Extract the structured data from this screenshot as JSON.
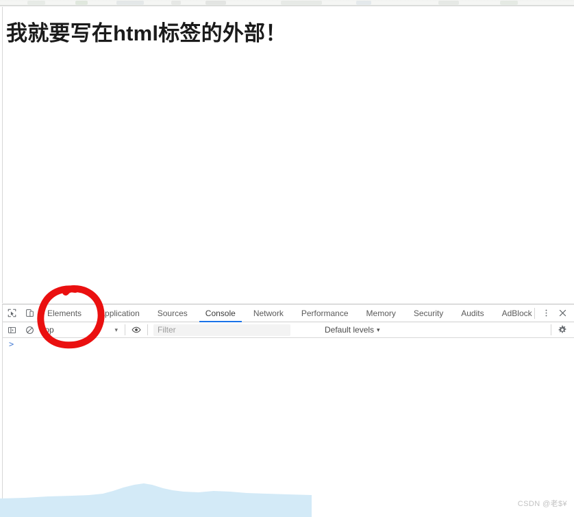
{
  "page": {
    "heading": "我就要写在html标签的外部！"
  },
  "devtools": {
    "tabs": [
      {
        "label": "Elements",
        "active": false
      },
      {
        "label": "Application",
        "active": false
      },
      {
        "label": "Sources",
        "active": false
      },
      {
        "label": "Console",
        "active": true
      },
      {
        "label": "Network",
        "active": false
      },
      {
        "label": "Performance",
        "active": false
      },
      {
        "label": "Memory",
        "active": false
      },
      {
        "label": "Security",
        "active": false
      },
      {
        "label": "Audits",
        "active": false
      },
      {
        "label": "AdBlock",
        "active": false
      }
    ],
    "left_icons": [
      {
        "name": "inspect-element-icon"
      },
      {
        "name": "device-toolbar-icon"
      }
    ],
    "right_icons": [
      {
        "name": "more-options-icon",
        "glyph": "⋮"
      },
      {
        "name": "close-devtools-icon",
        "glyph": "×"
      }
    ],
    "console_toolbar": {
      "sidebar_toggle": "console-sidebar-icon",
      "clear_console": "clear-console-icon",
      "context": "top",
      "context_caret": "▾",
      "eye_icon": "live-expression-icon",
      "filter_placeholder": "Filter",
      "levels_label": "Default levels",
      "levels_caret": "▾",
      "settings_icon": "settings-gear-icon"
    },
    "prompt": ">"
  },
  "watermark": "CSDN @老$¥",
  "colors": {
    "active_tab_underline": "#1a73e8",
    "annotation_red": "#ea1010",
    "hill_blue": "#d3eaf7",
    "prompt_blue": "#4a7fd4"
  }
}
